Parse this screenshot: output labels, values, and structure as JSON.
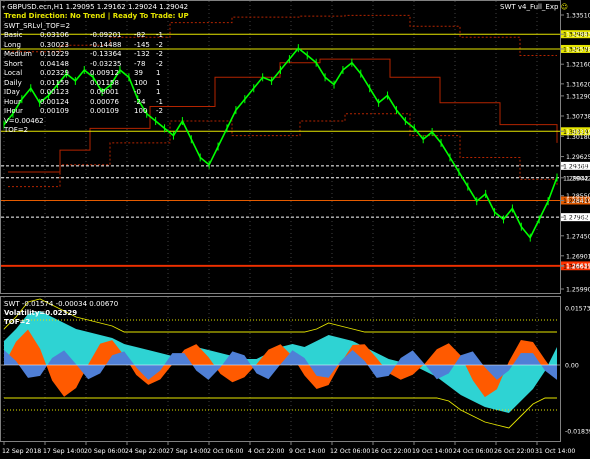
{
  "header": {
    "symbol_line": "GBPUSD.ecn,H1  1.29095 1.29162 1.29024 1.29042",
    "trend_line": "Trend Direction:  No Trend  |  Ready To Trade:  UP",
    "indicator_name": "SWT_SRLvl_TOF=2",
    "expert_label": "SWT v4_Full_Exp",
    "expert_icon": "smiley-icon",
    "v_label": "V=0.00462",
    "tof_label": "TOF=2"
  },
  "stats_rows": [
    {
      "name": "Basic",
      "v1": "0.03106",
      "v2": "-0.09201",
      "v3": "-82",
      "v4": "-1"
    },
    {
      "name": "Long",
      "v1": "0.30023",
      "v2": "-0.14488",
      "v3": "-145",
      "v4": "-2"
    },
    {
      "name": "Medium",
      "v1": "0.10229",
      "v2": "-0.13364",
      "v3": "-132",
      "v4": "-2"
    },
    {
      "name": "Short",
      "v1": "0.04148",
      "v2": "-0.03235",
      "v3": "-78",
      "v4": "-2"
    },
    {
      "name": "Local",
      "v1": "0.02329",
      "v2": "0.00912",
      "v3": "39",
      "v4": "1"
    },
    {
      "name": "Daily",
      "v1": "0.01159",
      "v2": "0.01158",
      "v3": "100",
      "v4": "1"
    },
    {
      "name": "IDay",
      "v1": "0.00123",
      "v2": "0.00001",
      "v3": "-0",
      "v4": "1"
    },
    {
      "name": "Hour",
      "v1": "0.00124",
      "v2": "0.00076",
      "v3": "-24",
      "v4": "-1"
    },
    {
      "name": "IHour",
      "v1": "0.00109",
      "v2": "0.00109",
      "v3": "100",
      "v4": "-2"
    }
  ],
  "price_axis": {
    "ticks": [
      "1.33510",
      "1.32983",
      "1.32578",
      "1.32160",
      "1.31620",
      "1.31290",
      "1.30738",
      "1.30319",
      "1.30180",
      "1.29625",
      "1.29369",
      "1.29042",
      "1.28550",
      "1.28419",
      "1.27962",
      "1.27450",
      "1.26901",
      "1.26637",
      "1.26615",
      "1.25990"
    ],
    "tagged_levels": [
      {
        "label": "1.32983",
        "color": "#e6e600",
        "bg": "#e6e600",
        "fg": "#000"
      },
      {
        "label": "1.32578",
        "color": "#e6e600",
        "bg": "#e6e600",
        "fg": "#000"
      },
      {
        "label": "1.30319",
        "color": "#e6e600",
        "bg": "#e6e600",
        "fg": "#000"
      },
      {
        "label": "1.29369",
        "color": "#ffffff",
        "bg": "#ffffff",
        "fg": "#000"
      },
      {
        "label": "1.29042",
        "color": "#ffffff",
        "bg": "#000000",
        "fg": "#fff"
      },
      {
        "label": "1.28419",
        "color": "#e65c00",
        "bg": "#e65c00",
        "fg": "#000"
      },
      {
        "label": "1.27962",
        "color": "#ffffff",
        "bg": "#ffffff",
        "fg": "#000"
      },
      {
        "label": "1.26637",
        "color": "#ff3300",
        "bg": "#ff3300",
        "fg": "#000"
      },
      {
        "label": "1.26615",
        "color": "#ff3300",
        "bg": "#ff3300",
        "fg": "#000"
      }
    ]
  },
  "lower_panel": {
    "label": "SWT -0.01574 -0.00034 0.00670",
    "volatility": "Volatility=0.02329",
    "tof": "TOF=2",
    "axis_top": "0.01573",
    "axis_mid": "0.00",
    "axis_bottom": "-0.01839"
  },
  "time_axis": [
    "12 Sep 2018",
    "17 Sep 14:00",
    "20 Sep 06:00",
    "24 Sep 22:00",
    "27 Sep 14:00",
    "2 Oct 06:00",
    "4 Oct 22:00",
    "9 Oct 14:00",
    "12 Oct 06:00",
    "16 Oct 22:00",
    "19 Oct 14:00",
    "24 Oct 06:00",
    "26 Oct 22:00",
    "31 Oct 14:00"
  ],
  "colors": {
    "background": "#000000",
    "candles": "#00ff00",
    "grid": "#404040",
    "resistance": "#e6e600",
    "support": "#ff3300",
    "channel": "#b32400",
    "cyan_fill": "#2ed3d3",
    "orange_fill": "#ff5a00",
    "blue_fill": "#4f7fd6",
    "envelope": "#e6e600"
  }
}
